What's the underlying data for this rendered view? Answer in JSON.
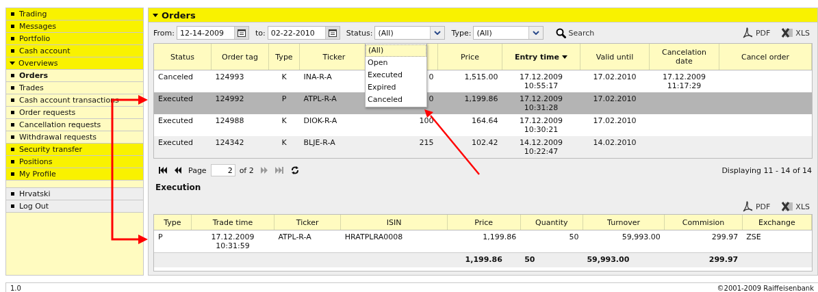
{
  "sidebar": {
    "items": [
      {
        "label": "Trading",
        "kind": "section",
        "expanded": false
      },
      {
        "label": "Messages",
        "kind": "section",
        "expanded": false
      },
      {
        "label": "Portfolio",
        "kind": "section",
        "expanded": false
      },
      {
        "label": "Cash account",
        "kind": "section",
        "expanded": false
      },
      {
        "label": "Overviews",
        "kind": "section",
        "expanded": true,
        "children": [
          {
            "label": "Orders",
            "selected": true
          },
          {
            "label": "Trades",
            "selected": false
          },
          {
            "label": "Cash account transactions",
            "selected": false
          },
          {
            "label": "Order requests",
            "selected": false
          },
          {
            "label": "Cancellation requests",
            "selected": false
          },
          {
            "label": "Withdrawal requests",
            "selected": false
          }
        ]
      },
      {
        "label": "Security transfer",
        "kind": "section",
        "expanded": false
      },
      {
        "label": "Positions",
        "kind": "section",
        "expanded": false
      },
      {
        "label": "My Profile",
        "kind": "section",
        "expanded": false
      },
      {
        "kind": "spacer"
      },
      {
        "label": "Hrvatski",
        "kind": "utility"
      },
      {
        "label": "Log Out",
        "kind": "utility"
      }
    ]
  },
  "orders_panel": {
    "title": "Orders",
    "expanded": true,
    "filters": {
      "from_label": "From:",
      "from_value": "12-14-2009",
      "to_label": "to:",
      "to_value": "02-22-2010",
      "status_label": "Status:",
      "status_value": "(All)",
      "type_label": "Type:",
      "type_value": "(All)",
      "search_button": "Search"
    },
    "status_dropdown": {
      "open": true,
      "options": [
        {
          "label": "(All)",
          "selected": true
        },
        {
          "label": "Open",
          "selected": false
        },
        {
          "label": "Executed",
          "selected": false
        },
        {
          "label": "Expired",
          "selected": false
        },
        {
          "label": "Canceled",
          "selected": false
        }
      ]
    },
    "exports": [
      {
        "label": "PDF",
        "kind": "pdf"
      },
      {
        "label": "XLS",
        "kind": "xls"
      }
    ],
    "table": {
      "columns": [
        {
          "label": "Status",
          "sorted": false
        },
        {
          "label": "Order tag",
          "sorted": false
        },
        {
          "label": "Type",
          "sorted": false
        },
        {
          "label": "Ticker",
          "sorted": false
        },
        {},
        {
          "label": "Price",
          "sorted": false
        },
        {
          "label": "Entry time",
          "sorted": true
        },
        {
          "label": "Valid until",
          "sorted": false
        },
        {
          "label": "Cancelation\ndate",
          "sorted": false
        },
        {
          "label": "Cancel order",
          "sorted": false
        }
      ],
      "rows": [
        {
          "selected": false,
          "cells": [
            "Canceled",
            "124993",
            "K",
            "INA-R-A",
            "0",
            "1,515.00",
            "17.12.2009\n10:55:17",
            "17.02.2010",
            "17.12.2009\n11:17:29"
          ]
        },
        {
          "selected": true,
          "cells": [
            "Executed",
            "124992",
            "P",
            "ATPL-R-A",
            "0",
            "1,199.86",
            "17.12.2009\n10:31:28",
            "17.02.2010"
          ]
        },
        {
          "selected": false,
          "cells": [
            "Executed",
            "124988",
            "K",
            "DIOK-R-A",
            "100",
            "164.64",
            "17.12.2009\n10:30:21",
            "17.02.2010"
          ]
        },
        {
          "selected": false,
          "cells": [
            "Executed",
            "124342",
            "K",
            "BLJE-R-A",
            "215",
            "102.42",
            "14.12.2009\n10:22:47",
            "14.02.2010"
          ]
        }
      ]
    },
    "pager": {
      "buttons": [
        {
          "kind": "first",
          "disabled": false
        },
        {
          "kind": "prev",
          "disabled": false
        },
        {
          "kind": "next",
          "disabled": true
        },
        {
          "kind": "last",
          "disabled": true
        },
        {
          "kind": "refresh",
          "disabled": false
        }
      ],
      "page_label": "Page",
      "page_value": "2",
      "of_label": "of 2",
      "summary": "Displaying 11 - 14 of 14"
    },
    "execution": {
      "title": "Execution",
      "exports": [
        {
          "label": "PDF",
          "kind": "pdf"
        },
        {
          "label": "XLS",
          "kind": "xls"
        }
      ],
      "table": {
        "columns": [
          {
            "label": "Type"
          },
          {
            "label": "Trade time"
          },
          {
            "label": "Ticker"
          },
          {
            "label": "ISIN"
          },
          {
            "label": "Price"
          },
          {
            "label": "Quantity"
          },
          {
            "label": "Turnover"
          },
          {
            "label": "Commision"
          },
          {
            "label": "Exchange"
          }
        ],
        "rows": [
          {
            "cells": [
              "P",
              "17.12.2009\n10:31:59",
              "ATPL-R-A",
              "HRATPLRA0008",
              "1,199.86",
              "50",
              "59,993.00",
              "299.97",
              "ZSE"
            ]
          }
        ],
        "totals": [
          "1,199.86",
          "50",
          "59,993.00",
          "299.97"
        ]
      }
    }
  },
  "footer": {
    "version": "1.0",
    "copyright": "©2001-2009 Raiffeisenbank"
  }
}
